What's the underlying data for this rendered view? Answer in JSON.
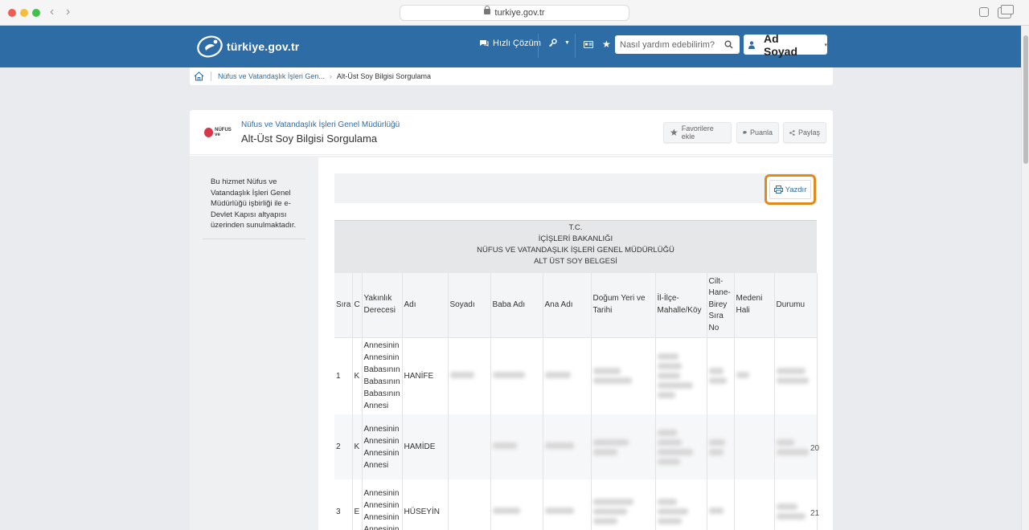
{
  "browser": {
    "url": "turkiye.gov.tr"
  },
  "header": {
    "logo_text": "türkiye.gov.tr",
    "hizli_cozum": "Hızlı Çözüm",
    "search_placeholder": "Nasıl yardım edebilirim?",
    "user_name": "Ad Soyad"
  },
  "breadcrumb": {
    "parent": "Nüfus ve Vatandaşlık İşleri Gen...",
    "current": "Alt-Üst Soy Bilgisi Sorgulama"
  },
  "service": {
    "institution_logo_text": "NÜFUS ve",
    "institution": "Nüfus ve Vatandaşlık İşleri Genel Müdürlüğü",
    "title": "Alt-Üst Soy Bilgisi Sorgulama",
    "actions": {
      "favorite": "Favorilere ekle",
      "rate": "Puanla",
      "share": "Paylaş"
    }
  },
  "sidebar": {
    "note": "Bu hizmet Nüfus ve Vatandaşlık İşleri Genel Müdürlüğü işbirliği ile e-Devlet Kapısı altyapısı üzerinden sunulmaktadır."
  },
  "toolbar": {
    "print_label": "Yazdır"
  },
  "document": {
    "heading_lines": [
      "T.C.",
      "İÇİŞLERİ BAKANLIĞI",
      "NÜFUS VE VATANDAŞLIK İŞLERİ GENEL MÜDÜRLÜĞÜ",
      "ALT ÜST SOY BELGESİ"
    ],
    "columns": [
      "Sıra",
      "C",
      "Yakınlık Derecesi",
      "Adı",
      "Soyadı",
      "Baba Adı",
      "Ana Adı",
      "Doğum Yeri ve Tarihi",
      "İl-İlçe-Mahalle/Köy",
      "Cilt-Hane-Birey Sıra No",
      "Medeni Hali",
      "Durumu"
    ],
    "rows": [
      {
        "sira": "1",
        "c": "K",
        "yakinlik": "Annesinin Annesinin Babasının Babasının Babasının Annesi",
        "adi": "HANİFE"
      },
      {
        "sira": "2",
        "c": "K",
        "yakinlik": "Annesinin Annesinin Annesinin Annesi",
        "adi": "HAMİDE"
      },
      {
        "sira": "3",
        "c": "E",
        "yakinlik": "Annesinin Annesinin Annesinin Annesinin",
        "adi": "HÜSEYİN"
      }
    ],
    "edge_digits": [
      "20",
      "21"
    ]
  }
}
